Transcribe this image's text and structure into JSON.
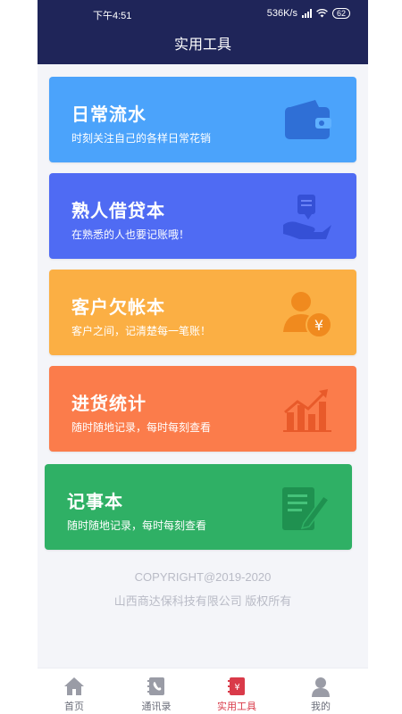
{
  "status_bar": {
    "time": "下午4:51",
    "network_speed": "536K/s",
    "battery": "62"
  },
  "header": {
    "title": "实用工具"
  },
  "cards": [
    {
      "title": "日常流水",
      "subtitle": "时刻关注自己的各样日常花销",
      "color": "#4ba3fb",
      "icon": "wallet-icon"
    },
    {
      "title": "熟人借贷本",
      "subtitle": "在熟悉的人也要记账哦！",
      "color": "#4f6bf3",
      "icon": "hand-money-icon"
    },
    {
      "title": "客户欠帐本",
      "subtitle": "客户之间，记清楚每一笔账！",
      "color": "#fbaf44",
      "icon": "customer-yen-icon"
    },
    {
      "title": "进货统计",
      "subtitle": "随时随地记录，每时每刻查看",
      "color": "#fb7c4b",
      "icon": "bar-chart-icon"
    },
    {
      "title": "记事本",
      "subtitle": "随时随地记录，每时每刻查看",
      "color": "#2fb065",
      "icon": "notebook-pen-icon"
    }
  ],
  "footer": {
    "copyright": "COPYRIGHT@2019-2020",
    "company": "山西商达保科技有限公司 版权所有"
  },
  "tabbar": [
    {
      "label": "首页",
      "icon": "home-icon",
      "active": false
    },
    {
      "label": "通讯录",
      "icon": "contacts-book-icon",
      "active": false
    },
    {
      "label": "实用工具",
      "icon": "tools-book-icon",
      "active": true
    },
    {
      "label": "我的",
      "icon": "person-icon",
      "active": false
    }
  ],
  "colors": {
    "header_bg": "#1f2559",
    "active_tab": "#d93a49",
    "inactive_tab": "#9a9ca6"
  }
}
